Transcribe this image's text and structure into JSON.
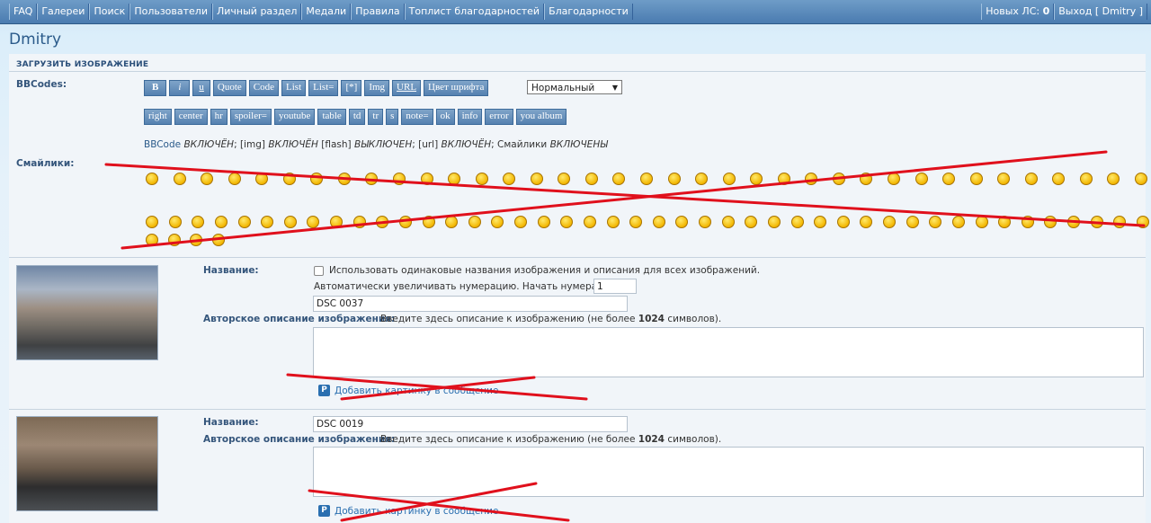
{
  "nav": {
    "left": [
      "FAQ",
      "Галереи",
      "Поиск",
      "Пользователи",
      "Личный раздел",
      "Медали",
      "Правила",
      "Топлист благодарностей",
      "Благодарности"
    ],
    "new_pm_label": "Новых ЛС:",
    "new_pm_count": "0",
    "logout": "Выход [ Dmitry ]"
  },
  "page": {
    "username": "Dmitry",
    "section_title": "ЗАГРУЗИТЬ ИЗОБРАЖЕНИЕ"
  },
  "bbcodes": {
    "label": "BBCodes:",
    "row1": [
      "B",
      "i",
      "u",
      "Quote",
      "Code",
      "List",
      "List=",
      "[*]",
      "Img",
      "URL",
      "Цвет шрифта"
    ],
    "row2": [
      "right",
      "center",
      "hr",
      "spoiler=",
      "youtube",
      "table",
      "td",
      "tr",
      "s",
      "note=",
      "ok",
      "info",
      "error",
      "you album"
    ],
    "font_size_selected": "Нормальный",
    "status": {
      "bbcode": "BBCode",
      "on1": "ВКЛЮЧЁН",
      "img": "; [img]",
      "on2": "ВКЛЮЧЁН",
      "flash": "[flash]",
      "off": "ВЫКЛЮЧЕН",
      "url": "; [url]",
      "on3": "ВКЛЮЧЁН",
      "smilies": "; Смайлики",
      "on4": "ВКЛЮЧЕНЫ"
    }
  },
  "smilies": {
    "label": "Смайлики:",
    "row1_count": 37,
    "row2_count": 44,
    "row3_count": 4
  },
  "images": [
    {
      "title_label": "Название:",
      "same_names_label": "Использовать одинаковые названия изображения и описания для всех изображений.",
      "numbering_label": "Автоматически увеличивать нумерацию. Начать нумерацию с:",
      "numbering_value": "1",
      "title_value": "DSC 0037",
      "desc_label": "Авторское описание изображения:",
      "desc_hint_pre": "Введите здесь описание к изображению (не более",
      "desc_hint_num": "1024",
      "desc_hint_post": "символов).",
      "add_link": "Добавить картинку в сообщение"
    },
    {
      "title_label": "Название:",
      "title_value": "DSC 0019",
      "desc_label": "Авторское описание изображения:",
      "desc_hint_pre": "Введите здесь описание к изображению (не более",
      "desc_hint_num": "1024",
      "desc_hint_post": "символов).",
      "add_link": "Добавить картинку в сообщение"
    }
  ],
  "colors": {
    "nav": "#4a7bb0",
    "cross": "#e0101c",
    "link": "#2a6fb0"
  }
}
